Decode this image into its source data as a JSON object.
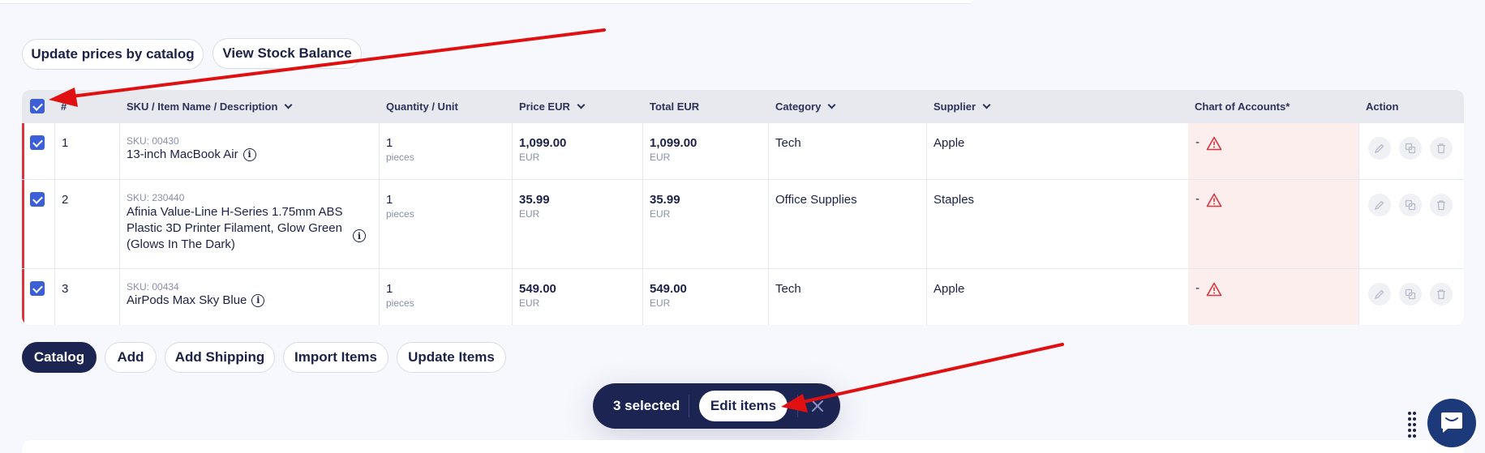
{
  "toolbar_top": {
    "update_prices": "Update prices by catalog",
    "view_stock": "View Stock Balance"
  },
  "table": {
    "headers": {
      "num": "#",
      "sku": "SKU / Item Name / Description",
      "qty": "Quantity / Unit",
      "price": "Price EUR",
      "total": "Total EUR",
      "category": "Category",
      "supplier": "Supplier",
      "coa": "Chart of Accounts*",
      "action": "Action"
    },
    "rows": [
      {
        "num": "1",
        "sku": "SKU: 00430",
        "name": "13-inch MacBook Air",
        "qty": "1",
        "unit": "pieces",
        "price": "1,099.00",
        "price_cur": "EUR",
        "total": "1,099.00",
        "total_cur": "EUR",
        "category": "Tech",
        "supplier": "Apple",
        "coa": "-"
      },
      {
        "num": "2",
        "sku": "SKU: 230440",
        "name": "Afinia Value-Line H-Series 1.75mm ABS Plastic 3D Printer Filament, Glow Green (Glows In The Dark)",
        "qty": "1",
        "unit": "pieces",
        "price": "35.99",
        "price_cur": "EUR",
        "total": "35.99",
        "total_cur": "EUR",
        "category": "Office Supplies",
        "supplier": "Staples",
        "coa": "-"
      },
      {
        "num": "3",
        "sku": "SKU: 00434",
        "name": "AirPods Max Sky Blue",
        "qty": "1",
        "unit": "pieces",
        "price": "549.00",
        "price_cur": "EUR",
        "total": "549.00",
        "total_cur": "EUR",
        "category": "Tech",
        "supplier": "Apple",
        "coa": "-"
      }
    ]
  },
  "toolbar_bottom": {
    "catalog": "Catalog",
    "add": "Add",
    "add_shipping": "Add Shipping",
    "import_items": "Import Items",
    "update_items": "Update Items"
  },
  "selection_bar": {
    "count": "3 selected",
    "edit": "Edit items"
  },
  "colors": {
    "accent": "#3a5fd9",
    "dark": "#1c2452",
    "warning": "#d8353f",
    "annotation_arrow": "#e01010"
  }
}
